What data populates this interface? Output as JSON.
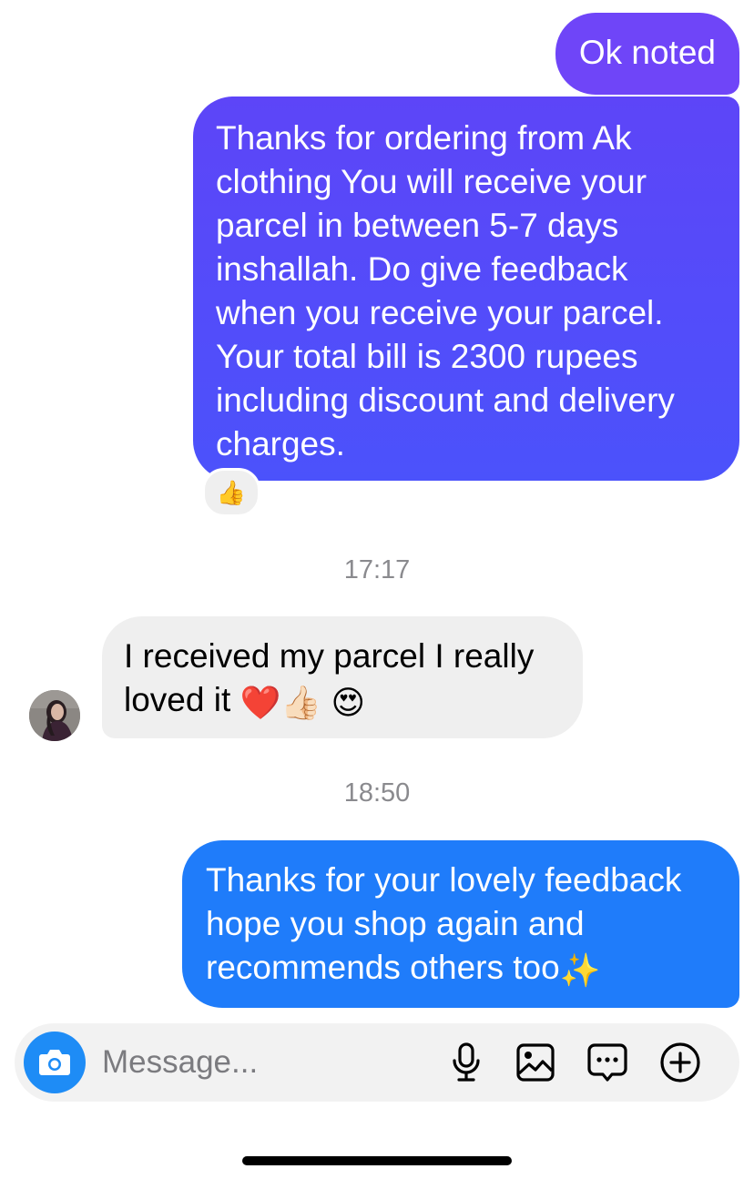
{
  "messages": [
    {
      "sender": "me",
      "text": "Ok noted"
    },
    {
      "sender": "me",
      "text": "Thanks for ordering from Ak clothing You will receive your parcel in between 5-7 days inshallah. Do give feedback when you receive your parcel. Your total bill is 2300 rupees including discount and delivery charges.",
      "reaction": "👍"
    },
    {
      "sender": "them",
      "text": "I received my parcel I really loved it",
      "emojis": [
        "❤️",
        "👍🏻",
        "😍"
      ]
    },
    {
      "sender": "me",
      "text": "Thanks for your lovely feedback hope you shop again and recommends others too",
      "emojis": [
        "✨"
      ]
    }
  ],
  "timestamps": [
    "17:17",
    "18:50"
  ],
  "composer": {
    "placeholder": "Message...",
    "icons": [
      "camera-icon",
      "microphone-icon",
      "gallery-icon",
      "sticker-icon",
      "plus-icon"
    ]
  },
  "colors": {
    "outgoing_purple": "#6f45f8",
    "outgoing_indigo": "#4b52fb",
    "outgoing_blue": "#1f7cfa",
    "incoming_gray": "#efefef",
    "camera_blue": "#1e8cf6",
    "timestamp_gray": "#8a8a8e"
  }
}
